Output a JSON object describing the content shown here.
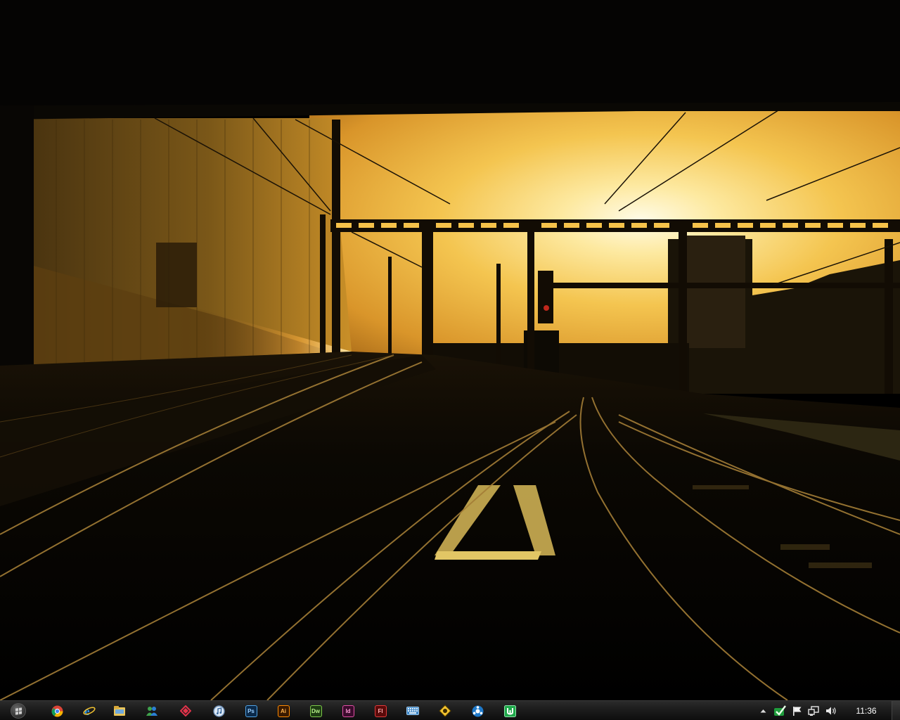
{
  "taskbar": {
    "pinned_apps": [
      {
        "name": "chrome-icon",
        "label": ""
      },
      {
        "name": "internet-explorer-icon",
        "label": ""
      },
      {
        "name": "windows-explorer-icon",
        "label": ""
      },
      {
        "name": "windows-live-messenger-icon",
        "label": ""
      },
      {
        "name": "app-red-icon",
        "label": ""
      },
      {
        "name": "itunes-icon",
        "label": ""
      },
      {
        "name": "photoshop-icon",
        "label": "Ps"
      },
      {
        "name": "illustrator-icon",
        "label": "Ai"
      },
      {
        "name": "dreamweaver-icon",
        "label": "Dw"
      },
      {
        "name": "indesign-icon",
        "label": "Id"
      },
      {
        "name": "flash-icon",
        "label": "Fl"
      },
      {
        "name": "keyboard-icon",
        "label": ""
      },
      {
        "name": "app-yellow-icon",
        "label": ""
      },
      {
        "name": "app-blue-icon",
        "label": ""
      },
      {
        "name": "utorrent-icon",
        "label": ""
      }
    ],
    "tray": {
      "icons": [
        "show-hidden-icons-icon",
        "checkmark-icon",
        "action-center-flag-icon",
        "network-icon",
        "volume-icon"
      ],
      "clock": "11:36"
    }
  },
  "colors": {
    "sky": "#f6c24a",
    "sun": "#fff5c8",
    "taskbar": "#1c1c1c"
  }
}
